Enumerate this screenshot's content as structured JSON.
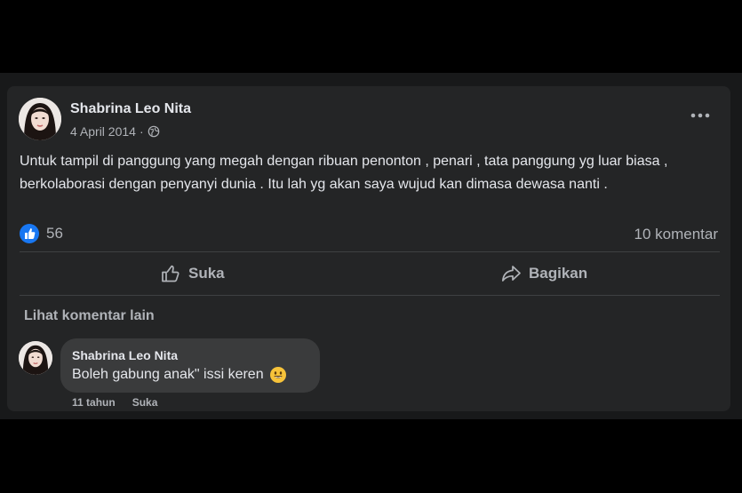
{
  "post": {
    "author": "Shabrina Leo Nita",
    "date": "4 April 2014",
    "separator": "·",
    "text": "Untuk tampil di panggung yang megah dengan ribuan penonton , penari , tata panggung yg luar biasa , berkolaborasi dengan penyanyi dunia . Itu lah yg akan saya wujud kan dimasa dewasa nanti .",
    "like_count": "56",
    "comment_count": "10 komentar"
  },
  "actions": {
    "like_label": "Suka",
    "share_label": "Bagikan"
  },
  "comments_section": {
    "more_label": "Lihat komentar lain",
    "comments": [
      {
        "author": "Shabrina Leo Nita",
        "text": "Boleh gabung anak\" issi keren",
        "time": "11 tahun",
        "like_label": "Suka"
      }
    ]
  },
  "colors": {
    "background": "#18191a",
    "card": "#242526",
    "bubble": "#3a3b3c",
    "primary_text": "#e4e6eb",
    "secondary_text": "#b0b3b8",
    "like_blue": "#1877f2"
  },
  "icons": [
    "globe-icon",
    "more-options-icon",
    "like-reaction-icon",
    "thumbs-up-icon",
    "share-icon",
    "smile-emoji-icon"
  ]
}
